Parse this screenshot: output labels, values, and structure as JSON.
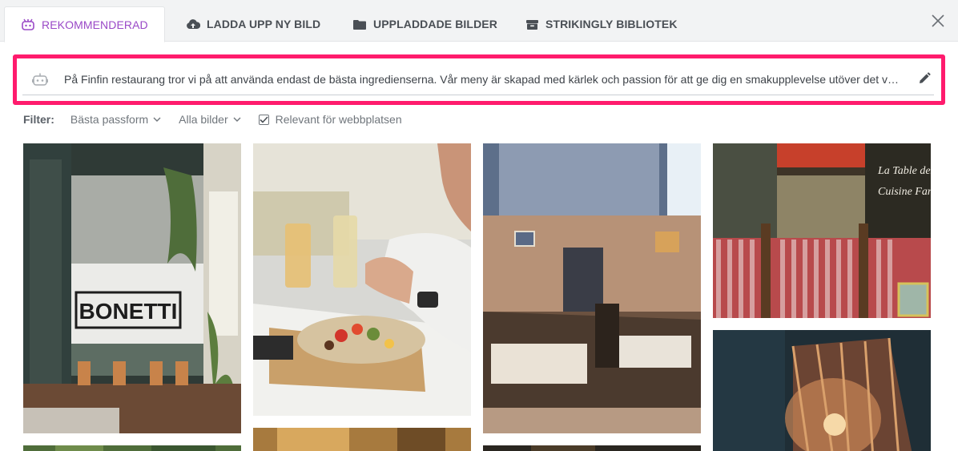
{
  "tabs": {
    "recommended": "REKOMMENDERAD",
    "upload": "LADDA UPP NY BILD",
    "uploaded": "UPPLADDADE BILDER",
    "library": "STRIKINGLY BIBLIOTEK"
  },
  "prompt": {
    "text": "På Finfin restaurang tror vi på att använda endast de bästa ingredienserna. Vår meny är skapad med kärlek och passion för att ge dig en smakupplevelse utöver det vanliga."
  },
  "filters": {
    "label": "Filter:",
    "fit": "Bästa passform",
    "all_images": "Alla bilder",
    "relevant": "Relevant för webbplatsen",
    "relevant_checked": true
  },
  "images": {
    "bonetti_sign": "BONETTI"
  },
  "colors": {
    "accent": "#9a49c7",
    "highlight": "#ff1b6d"
  }
}
